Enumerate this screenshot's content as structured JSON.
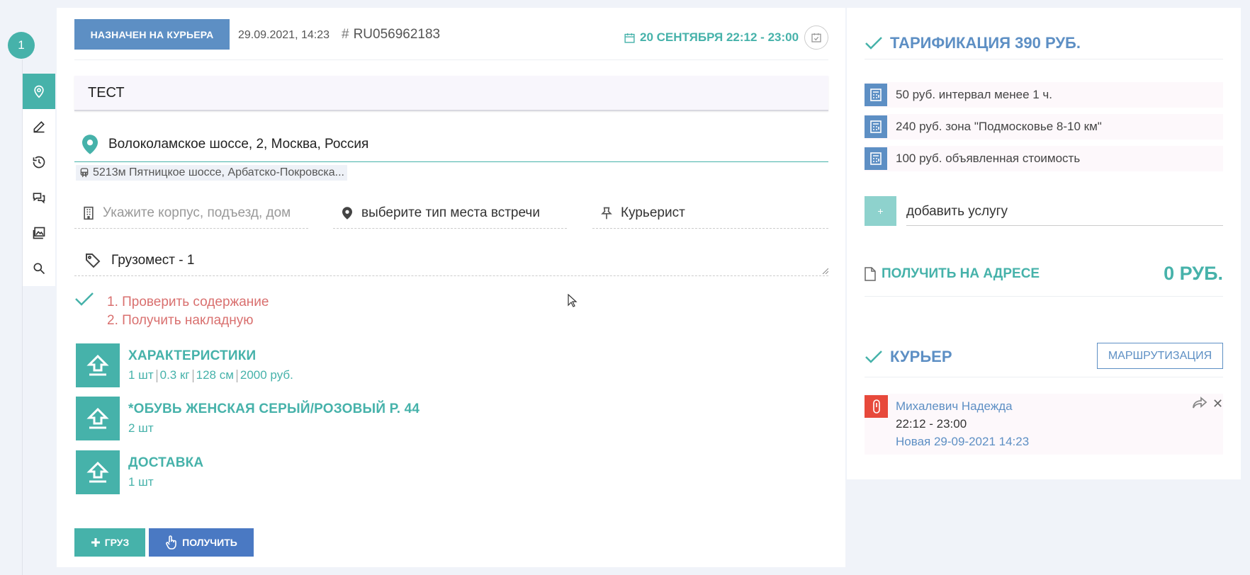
{
  "step": {
    "number": "1"
  },
  "order": {
    "status_label": "НАЗНАЧЕН НА КУРЬЕРА",
    "created": "29.09.2021, 14:23",
    "number": "RU056962183",
    "delivery_window": "20 СЕНТЯБРЯ 22:12 - 23:00",
    "title": "ТЕСТ",
    "address": "Волоколамское шоссе, 2, Москва, Россия",
    "metro": "5213м Пятницкое шоссе, Арбатско-Покровска...",
    "building_placeholder": "Укажите корпус, подъезд, дом",
    "meeting_place": "выберите тип места встречи",
    "courier_type": "Курьерист",
    "cargo_places": "Грузомест - 1"
  },
  "tasks": [
    "1. Проверить содержание",
    "2. Получить накладную"
  ],
  "products": [
    {
      "name": "ХАРАКТЕРИСТИКИ",
      "meta": [
        "1 шт",
        "0.3 кг",
        "128 см",
        "2000 руб."
      ]
    },
    {
      "name": "*ОБУВЬ ЖЕНСКАЯ СЕРЫЙ/РОЗОВЫЙ Р. 44",
      "meta": [
        "2 шт"
      ]
    },
    {
      "name": "ДОСТАВКА",
      "meta": [
        "1 шт"
      ]
    }
  ],
  "actions": {
    "cargo": "ГРУЗ",
    "receive": "ПОЛУЧИТЬ"
  },
  "tariff": {
    "title": "ТАРИФИКАЦИЯ 390 РУБ.",
    "items": [
      "50 руб. интервал менее 1 ч.",
      "240 руб. зона \"Подмосковье 8-10 км\"",
      "100 руб. объявленная стоимость"
    ],
    "add_plus": "+",
    "add_service": "добавить услугу"
  },
  "collect": {
    "label": "ПОЛУЧИТЬ НА АДРЕСЕ",
    "amount": "0 РУБ."
  },
  "courier": {
    "title": "КУРЬЕР",
    "route_button": "МАРШРУТИЗАЦИЯ",
    "name": "Михалевич Надежда",
    "time": "22:12 - 23:00",
    "status": "Новая 29-09-2021 14:23"
  },
  "colors": {
    "teal": "#46b2aa",
    "blue": "#5d8fc4",
    "red": "#e7493b",
    "task": "#d9706f"
  }
}
